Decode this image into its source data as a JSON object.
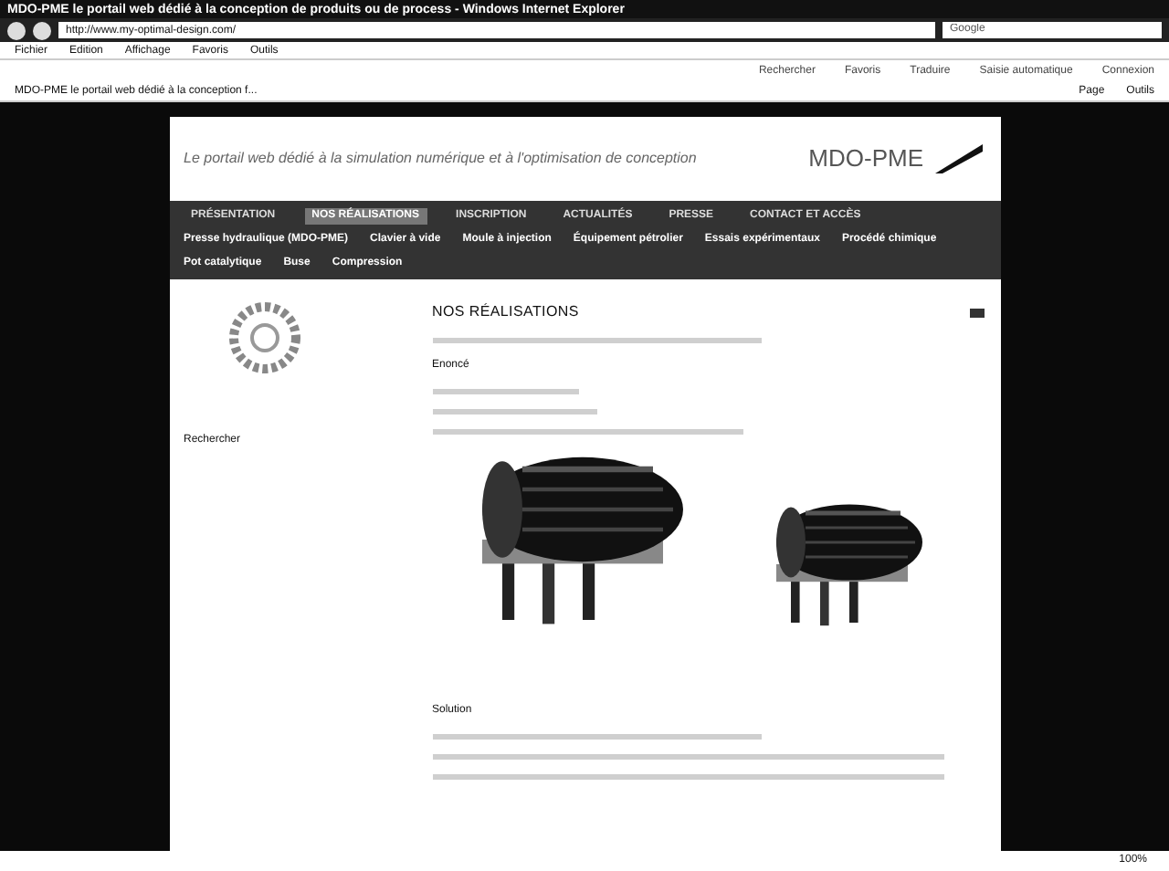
{
  "window": {
    "title": "MDO-PME le portail web dédié à la conception de produits ou de process - Windows Internet Explorer"
  },
  "address_bar": {
    "url": "http://www.my-optimal-design.com/"
  },
  "search": {
    "placeholder": "Google"
  },
  "menu": [
    "Fichier",
    "Edition",
    "Affichage",
    "Favoris",
    "Outils"
  ],
  "toolbar": [
    "Rechercher",
    "Favoris",
    "Traduire",
    "Saisie automatique",
    "Connexion"
  ],
  "tab": {
    "label": "MDO-PME le portail web dédié à la conception f..."
  },
  "command_bar": [
    "Page",
    "Outils"
  ],
  "site": {
    "tagline": "Le portail web dédié à la simulation numérique et à l'optimisation de conception",
    "logo": "MDO-PME",
    "nav": [
      {
        "label": "PRÉSENTATION",
        "selected": false
      },
      {
        "label": "NOS RÉALISATIONS",
        "selected": true
      },
      {
        "label": "INSCRIPTION",
        "selected": false
      },
      {
        "label": "ACTUALITÉS",
        "selected": false
      },
      {
        "label": "PRESSE",
        "selected": false
      },
      {
        "label": "CONTACT ET ACCÈS",
        "selected": false
      }
    ],
    "subnav": [
      "Presse hydraulique (MDO-PME)",
      "Clavier à vide",
      "Moule à injection",
      "Équipement pétrolier",
      "Essais expérimentaux",
      "Procédé chimique",
      "Pot catalytique",
      "Buse",
      "Compression"
    ],
    "sidebar": {
      "search_label": "Rechercher"
    },
    "heading": "NOS RÉALISATIONS",
    "sections": [
      "Enoncé",
      "Solution"
    ]
  },
  "status_bar": {
    "zoom": "100%"
  }
}
